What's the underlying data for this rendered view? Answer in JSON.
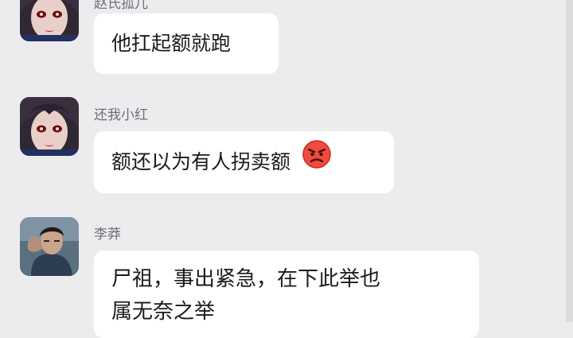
{
  "messages": [
    {
      "sender": "赵氏孤儿",
      "text": "他扛起额就跑",
      "avatar": "anime-girl-avatar"
    },
    {
      "sender": "还我小红",
      "text": "额还以为有人拐卖额",
      "emoji": "angry-face-icon",
      "avatar": "anime-girl-avatar"
    },
    {
      "sender": "李莽",
      "lines": [
        "尸祖，事出紧急，在下此举也",
        "属无奈之举"
      ],
      "avatar": "male-character-avatar"
    }
  ],
  "colors": {
    "background": "#ececef",
    "bubble": "#ffffff",
    "sender_text": "#6f6f74",
    "message_text": "#1b1b1b"
  }
}
